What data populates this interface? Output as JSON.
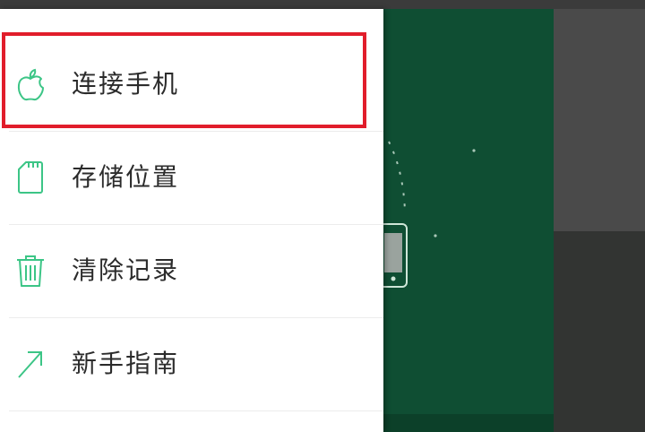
{
  "menu": {
    "items": [
      {
        "label": "连接手机",
        "icon": "apple-icon"
      },
      {
        "label": "存储位置",
        "icon": "sd-card-icon"
      },
      {
        "label": "清除记录",
        "icon": "trash-icon"
      },
      {
        "label": "新手指南",
        "icon": "arrow-up-right-icon"
      }
    ]
  },
  "colors": {
    "accent": "#3cc586",
    "highlight": "#e11d2b",
    "panel": "#0f4e33"
  }
}
